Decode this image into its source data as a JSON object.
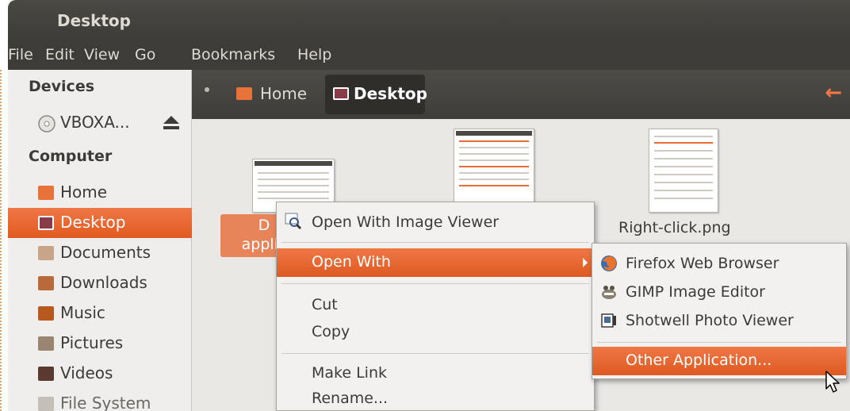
{
  "window": {
    "title": "Desktop"
  },
  "menubar": [
    "File",
    "Edit",
    "View",
    "Go",
    "Bookmarks",
    "Help"
  ],
  "sidebar": {
    "devices_heading": "Devices",
    "device": "VBOXA...",
    "computer_heading": "Computer",
    "places": [
      {
        "label": "Home",
        "icon": "home-folder-icon",
        "color": "#e8733a"
      },
      {
        "label": "Desktop",
        "icon": "desktop-folder-icon",
        "color": "#8a3b4a",
        "selected": true
      },
      {
        "label": "Documents",
        "icon": "documents-folder-icon",
        "color": "#c8a488"
      },
      {
        "label": "Downloads",
        "icon": "downloads-folder-icon",
        "color": "#b86a3a"
      },
      {
        "label": "Music",
        "icon": "music-folder-icon",
        "color": "#b85a20"
      },
      {
        "label": "Pictures",
        "icon": "pictures-folder-icon",
        "color": "#9a8670"
      },
      {
        "label": "Videos",
        "icon": "videos-folder-icon",
        "color": "#5a3a30"
      },
      {
        "label": "File System",
        "icon": "file-system-icon",
        "color": "#c4c0b8"
      }
    ]
  },
  "pathbar": {
    "crumbs": [
      {
        "label": "Home",
        "icon": "home-folder-icon"
      },
      {
        "label": "Desktop",
        "icon": "desktop-folder-icon",
        "active": true
      }
    ]
  },
  "files": {
    "selected_label_line1": "D",
    "selected_label_line2": "applic",
    "right_click_label": "Right-click.png"
  },
  "context_menu": {
    "open_with_viewer": "Open With Image Viewer",
    "open_with": "Open With",
    "cut": "Cut",
    "copy": "Copy",
    "make_link": "Make Link",
    "rename": "Rename..."
  },
  "submenu": {
    "apps": [
      "Firefox Web Browser",
      "GIMP Image Editor",
      "Shotwell Photo Viewer"
    ],
    "other": "Other Application..."
  },
  "colors": {
    "accent": "#f07746",
    "titlebar": "#3d3c38",
    "sidebar": "#efeeec"
  }
}
